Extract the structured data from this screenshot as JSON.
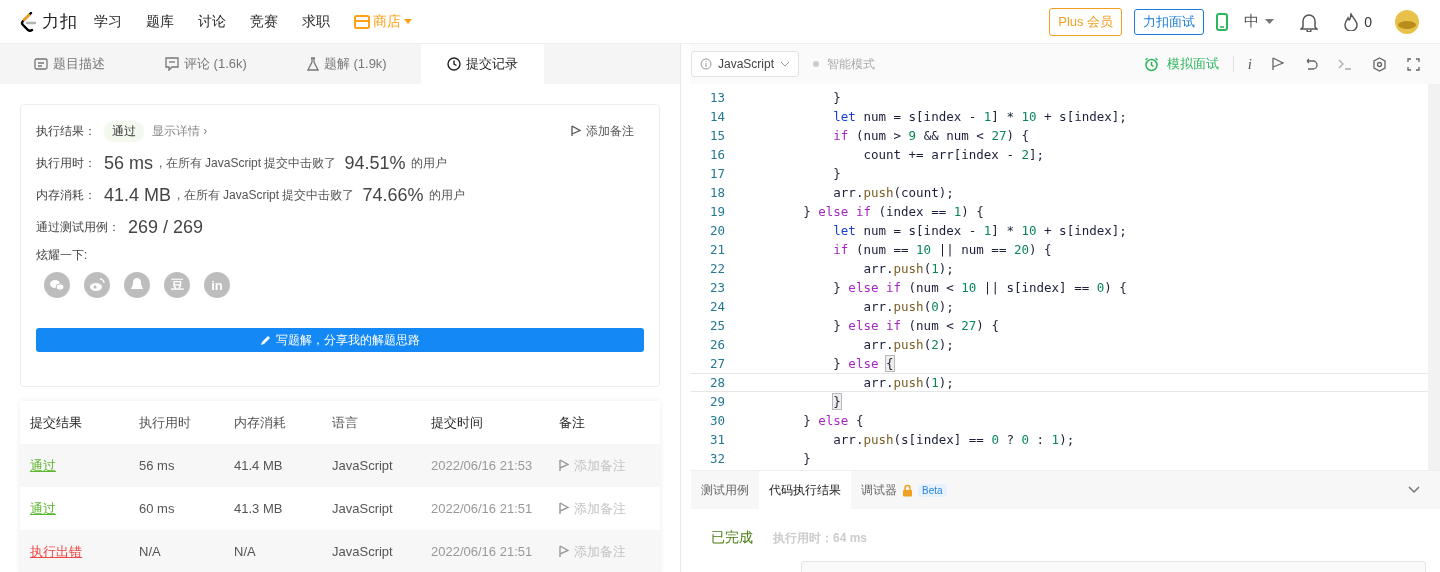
{
  "nav": {
    "logo": "力扣",
    "items": [
      {
        "label": "学习",
        "kind": "plain"
      },
      {
        "label": "题库",
        "kind": "plain"
      },
      {
        "label": "讨论",
        "kind": "plain"
      },
      {
        "label": "竞赛",
        "kind": "plain"
      },
      {
        "label": "求职",
        "kind": "plain"
      },
      {
        "label": "商店",
        "kind": "store"
      }
    ],
    "plus": "Plus 会员",
    "interview": "力扣面试",
    "lang": {
      "label": "中",
      "expanded": false
    },
    "points": "0"
  },
  "left_tabs": [
    {
      "label": "题目描述",
      "selected": false
    },
    {
      "label": "评论 (1.6k)",
      "selected": false
    },
    {
      "label": "题解 (1.9k)",
      "selected": false
    },
    {
      "label": "提交记录",
      "selected": true
    }
  ],
  "result": {
    "label": "执行结果：",
    "status": "通过",
    "details": "显示详情 ›",
    "note": "添加备注",
    "stats": [
      {
        "label": "执行用时：",
        "value": "56 ms",
        "text": ", 在所有 JavaScript 提交中击败了",
        "percent": "94.51%",
        "suffix": "的用户"
      },
      {
        "label": "内存消耗：",
        "value": "41.4 MB",
        "text": ", 在所有 JavaScript 提交中击败了",
        "percent": "74.66%",
        "suffix": "的用户"
      }
    ],
    "cases_label": "通过测试用例：",
    "cases": "269 / 269",
    "share_label": "炫耀一下:",
    "share": [
      {
        "kind": "chat"
      },
      {
        "kind": "bird"
      },
      {
        "kind": "penguin"
      },
      {
        "kind": "text",
        "text": "豆"
      },
      {
        "kind": "text",
        "text": "in"
      }
    ],
    "write_button": "写题解，分享我的解题思路"
  },
  "table": {
    "columns": [
      "提交结果",
      "执行用时",
      "内存消耗",
      "语言",
      "提交时间",
      "备注"
    ],
    "rows": [
      {
        "status": "通过",
        "kind": "pass",
        "time": "56 ms",
        "memory": "41.4 MB",
        "language": "JavaScript",
        "submitted": "2022/06/16 21:53",
        "note": "添加备注"
      },
      {
        "status": "通过",
        "kind": "pass",
        "time": "60 ms",
        "memory": "41.3 MB",
        "language": "JavaScript",
        "submitted": "2022/06/16 21:51",
        "note": "添加备注"
      },
      {
        "status": "执行出错",
        "kind": "error",
        "time": "N/A",
        "memory": "N/A",
        "language": "JavaScript",
        "submitted": "2022/06/16 21:51",
        "note": "添加备注"
      }
    ]
  },
  "editor": {
    "language": "JavaScript",
    "smart_mode": {
      "label": "智能模式",
      "on": false
    },
    "mock_interview": "模拟面试",
    "info": "i",
    "lines": [
      {
        "number": "13",
        "current": false,
        "tokens": [
          {
            "kind": "plain",
            "text": "            }"
          }
        ]
      },
      {
        "number": "14",
        "current": false,
        "tokens": [
          {
            "kind": "decl",
            "text": "            let"
          },
          {
            "kind": "plain",
            "text": " num = s[index - "
          },
          {
            "kind": "number",
            "text": "1"
          },
          {
            "kind": "plain",
            "text": "] * "
          },
          {
            "kind": "number",
            "text": "10"
          },
          {
            "kind": "plain",
            "text": " + s[index];"
          }
        ]
      },
      {
        "number": "15",
        "current": false,
        "tokens": [
          {
            "kind": "keyword",
            "text": "            if"
          },
          {
            "kind": "plain",
            "text": " (num > "
          },
          {
            "kind": "number",
            "text": "9"
          },
          {
            "kind": "plain",
            "text": " && num < "
          },
          {
            "kind": "number",
            "text": "27"
          },
          {
            "kind": "plain",
            "text": ") {"
          }
        ]
      },
      {
        "number": "16",
        "current": false,
        "tokens": [
          {
            "kind": "plain",
            "text": "                count += arr[index - "
          },
          {
            "kind": "number",
            "text": "2"
          },
          {
            "kind": "plain",
            "text": "];"
          }
        ]
      },
      {
        "number": "17",
        "current": false,
        "tokens": [
          {
            "kind": "plain",
            "text": "            }"
          }
        ]
      },
      {
        "number": "18",
        "current": false,
        "tokens": [
          {
            "kind": "plain",
            "text": "            arr."
          },
          {
            "kind": "method",
            "text": "push"
          },
          {
            "kind": "plain",
            "text": "(count);"
          }
        ]
      },
      {
        "number": "19",
        "current": false,
        "tokens": [
          {
            "kind": "plain",
            "text": "        } "
          },
          {
            "kind": "keyword",
            "text": "else if"
          },
          {
            "kind": "plain",
            "text": " (index == "
          },
          {
            "kind": "number",
            "text": "1"
          },
          {
            "kind": "plain",
            "text": ") {"
          }
        ]
      },
      {
        "number": "20",
        "current": false,
        "tokens": [
          {
            "kind": "decl",
            "text": "            let"
          },
          {
            "kind": "plain",
            "text": " num = s[index - "
          },
          {
            "kind": "number",
            "text": "1"
          },
          {
            "kind": "plain",
            "text": "] * "
          },
          {
            "kind": "number",
            "text": "10"
          },
          {
            "kind": "plain",
            "text": " + s[index];"
          }
        ]
      },
      {
        "number": "21",
        "current": false,
        "tokens": [
          {
            "kind": "keyword",
            "text": "            if"
          },
          {
            "kind": "plain",
            "text": " (num == "
          },
          {
            "kind": "number",
            "text": "10"
          },
          {
            "kind": "plain",
            "text": " || num == "
          },
          {
            "kind": "number",
            "text": "20"
          },
          {
            "kind": "plain",
            "text": ") {"
          }
        ]
      },
      {
        "number": "22",
        "current": false,
        "tokens": [
          {
            "kind": "plain",
            "text": "                arr."
          },
          {
            "kind": "method",
            "text": "push"
          },
          {
            "kind": "plain",
            "text": "("
          },
          {
            "kind": "number",
            "text": "1"
          },
          {
            "kind": "plain",
            "text": ");"
          }
        ]
      },
      {
        "number": "23",
        "current": false,
        "tokens": [
          {
            "kind": "plain",
            "text": "            } "
          },
          {
            "kind": "keyword",
            "text": "else if"
          },
          {
            "kind": "plain",
            "text": " (num < "
          },
          {
            "kind": "number",
            "text": "10"
          },
          {
            "kind": "plain",
            "text": " || s[index] == "
          },
          {
            "kind": "number",
            "text": "0"
          },
          {
            "kind": "plain",
            "text": ") {"
          }
        ]
      },
      {
        "number": "24",
        "current": false,
        "tokens": [
          {
            "kind": "plain",
            "text": "                arr."
          },
          {
            "kind": "method",
            "text": "push"
          },
          {
            "kind": "plain",
            "text": "("
          },
          {
            "kind": "number",
            "text": "0"
          },
          {
            "kind": "plain",
            "text": ");"
          }
        ]
      },
      {
        "number": "25",
        "current": false,
        "tokens": [
          {
            "kind": "plain",
            "text": "            } "
          },
          {
            "kind": "keyword",
            "text": "else if"
          },
          {
            "kind": "plain",
            "text": " (num < "
          },
          {
            "kind": "number",
            "text": "27"
          },
          {
            "kind": "plain",
            "text": ") {"
          }
        ]
      },
      {
        "number": "26",
        "current": false,
        "tokens": [
          {
            "kind": "plain",
            "text": "                arr."
          },
          {
            "kind": "method",
            "text": "push"
          },
          {
            "kind": "plain",
            "text": "("
          },
          {
            "kind": "number",
            "text": "2"
          },
          {
            "kind": "plain",
            "text": ");"
          }
        ]
      },
      {
        "number": "27",
        "current": false,
        "tokens": [
          {
            "kind": "plain",
            "text": "            } "
          },
          {
            "kind": "keyword",
            "text": "else "
          },
          {
            "kind": "match",
            "text": "{"
          }
        ]
      },
      {
        "number": "28",
        "current": true,
        "tokens": [
          {
            "kind": "plain",
            "text": "                arr."
          },
          {
            "kind": "method",
            "text": "push"
          },
          {
            "kind": "plain",
            "text": "("
          },
          {
            "kind": "number",
            "text": "1"
          },
          {
            "kind": "plain",
            "text": ");"
          }
        ]
      },
      {
        "number": "29",
        "current": false,
        "tokens": [
          {
            "kind": "match",
            "text": "            }"
          }
        ]
      },
      {
        "number": "30",
        "current": false,
        "tokens": [
          {
            "kind": "plain",
            "text": "        } "
          },
          {
            "kind": "keyword",
            "text": "else"
          },
          {
            "kind": "plain",
            "text": " {"
          }
        ]
      },
      {
        "number": "31",
        "current": false,
        "tokens": [
          {
            "kind": "plain",
            "text": "            arr."
          },
          {
            "kind": "method",
            "text": "push"
          },
          {
            "kind": "plain",
            "text": "(s[index] == "
          },
          {
            "kind": "number",
            "text": "0"
          },
          {
            "kind": "plain",
            "text": " ? "
          },
          {
            "kind": "number",
            "text": "0"
          },
          {
            "kind": "plain",
            "text": " : "
          },
          {
            "kind": "number",
            "text": "1"
          },
          {
            "kind": "plain",
            "text": ");"
          }
        ]
      },
      {
        "number": "32",
        "current": false,
        "tokens": [
          {
            "kind": "plain",
            "text": "        }"
          }
        ]
      }
    ]
  },
  "console": {
    "tabs": [
      {
        "label": "测试用例",
        "selected": false
      },
      {
        "label": "代码执行结果",
        "selected": true
      },
      {
        "label": "调试器",
        "selected": false,
        "locked": true,
        "badge": "Beta"
      }
    ],
    "status": "已完成",
    "runtime": "执行用时：64 ms"
  }
}
